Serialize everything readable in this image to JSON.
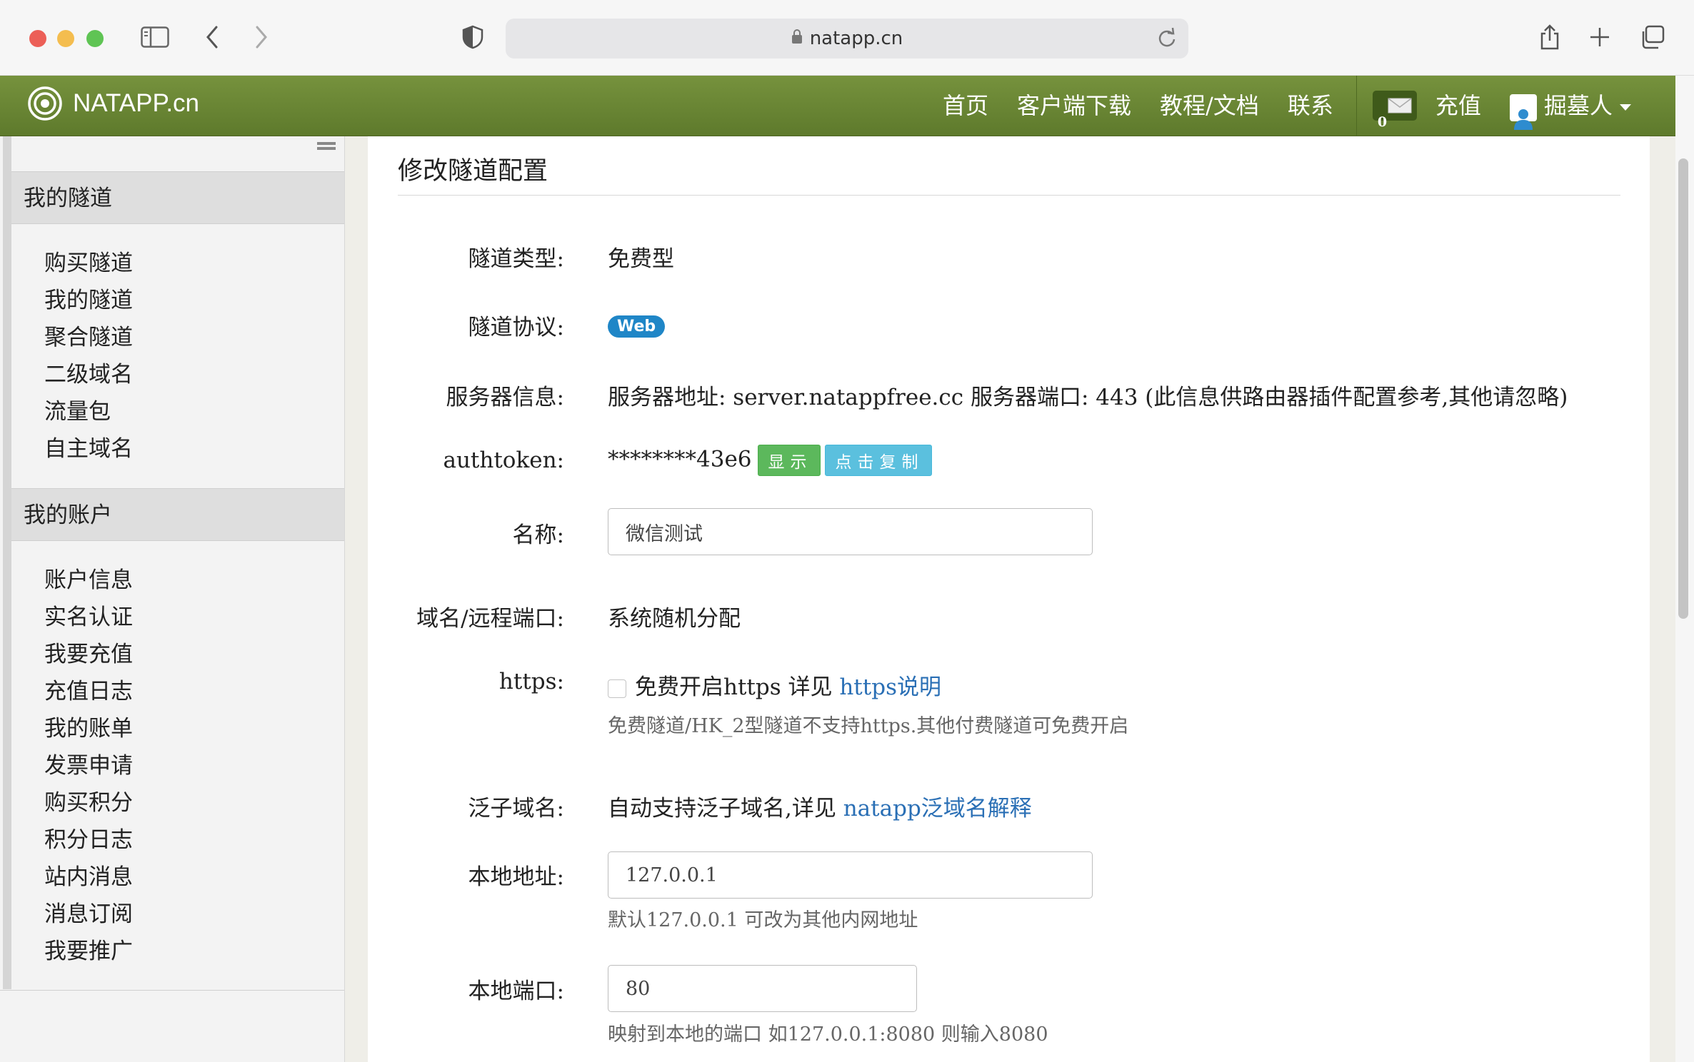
{
  "browser": {
    "url": "natapp.cn"
  },
  "header": {
    "logo": "NATAPP.cn",
    "nav": [
      "首页",
      "客户端下载",
      "教程/文档",
      "联系"
    ],
    "message_count": "0",
    "recharge": "充值",
    "user": "掘墓人"
  },
  "sidebar": {
    "section1": {
      "title": "我的隧道",
      "items": [
        "购买隧道",
        "我的隧道",
        "聚合隧道",
        "二级域名",
        "流量包",
        "自主域名"
      ]
    },
    "section2": {
      "title": "我的账户",
      "items": [
        "账户信息",
        "实名认证",
        "我要充值",
        "充值日志",
        "我的账单",
        "发票申请",
        "购买积分",
        "积分日志",
        "站内消息",
        "消息订阅",
        "我要推广"
      ]
    }
  },
  "form": {
    "title": "修改隧道配置",
    "type_label": "隧道类型:",
    "type_value": "免费型",
    "protocol_label": "隧道协议:",
    "protocol_value": "Web",
    "server_label": "服务器信息:",
    "server_value": "服务器地址: server.natappfree.cc 服务器端口: 443 (此信息供路由器插件配置参考,其他请忽略)",
    "authtoken_label": "authtoken:",
    "authtoken_value": "********43e6",
    "show_button": "显示",
    "copy_button": "点击复制",
    "name_label": "名称:",
    "name_value": "微信测试",
    "domain_label": "域名/远程端口:",
    "domain_value": "系统随机分配",
    "https_label": "https:",
    "https_checkbox_text": "免费开启https 详见 ",
    "https_link": "https说明",
    "https_help": "免费隧道/HK_2型隧道不支持https.其他付费隧道可免费开启",
    "wildcard_label": "泛子域名:",
    "wildcard_text": "自动支持泛子域名,详见 ",
    "wildcard_link": "natapp泛域名解释",
    "local_addr_label": "本地地址:",
    "local_addr_value": "127.0.0.1",
    "local_addr_help": "默认127.0.0.1 可改为其他内网地址",
    "local_port_label": "本地端口:",
    "local_port_value": "80",
    "local_port_help": "映射到本地的端口 如127.0.0.1:8080 则输入8080"
  }
}
